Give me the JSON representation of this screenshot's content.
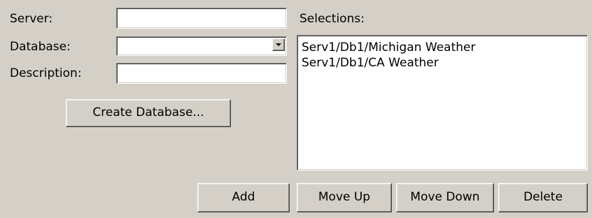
{
  "form": {
    "server_label": "Server:",
    "server_value": "",
    "database_label": "Database:",
    "database_value": "",
    "description_label": "Description:",
    "description_value": "",
    "create_database_label": "Create Database..."
  },
  "selections": {
    "label": "Selections:",
    "items": [
      "Serv1/Db1/Michigan Weather",
      "Serv1/Db1/CA Weather"
    ]
  },
  "buttons": {
    "add": "Add",
    "move_up": "Move Up",
    "move_down": "Move Down",
    "delete": "Delete"
  }
}
